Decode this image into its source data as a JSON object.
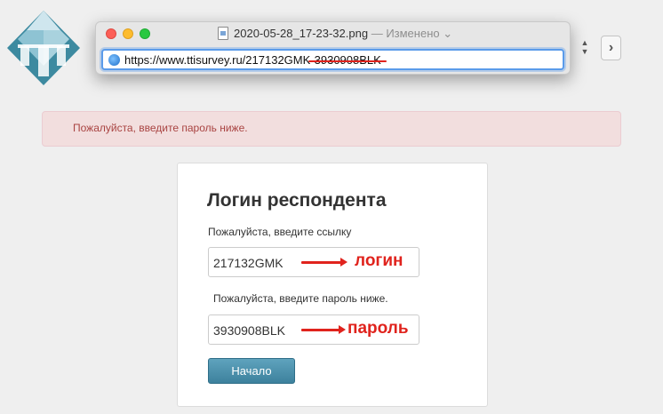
{
  "window": {
    "title": "2020-05-28_17-23-32.png",
    "edited_label": "— Изменено",
    "chevron": "⌄"
  },
  "address_bar": {
    "url_visible": "https://www.ttisurvey.ru/217132GMK",
    "url_struck": "-3930908BLK"
  },
  "controls": {
    "stepper_up": "▲",
    "stepper_down": "▼",
    "forward_glyph": "›"
  },
  "alert": {
    "message": "Пожалуйста, введите пароль ниже."
  },
  "login": {
    "title": "Логин респондента",
    "link_label": "Пожалуйста, введите ссылку",
    "link_value": "217132GMK",
    "link_annotation": "логин",
    "password_label": "Пожалуйста, введите пароль ниже.",
    "password_value": "3930908BLK",
    "password_annotation": "пароль",
    "start_button": "Начало"
  },
  "colors": {
    "alert_bg": "#f2dede",
    "alert_text": "#a94442",
    "annotation": "#e0231d",
    "button": "#3d819d"
  }
}
